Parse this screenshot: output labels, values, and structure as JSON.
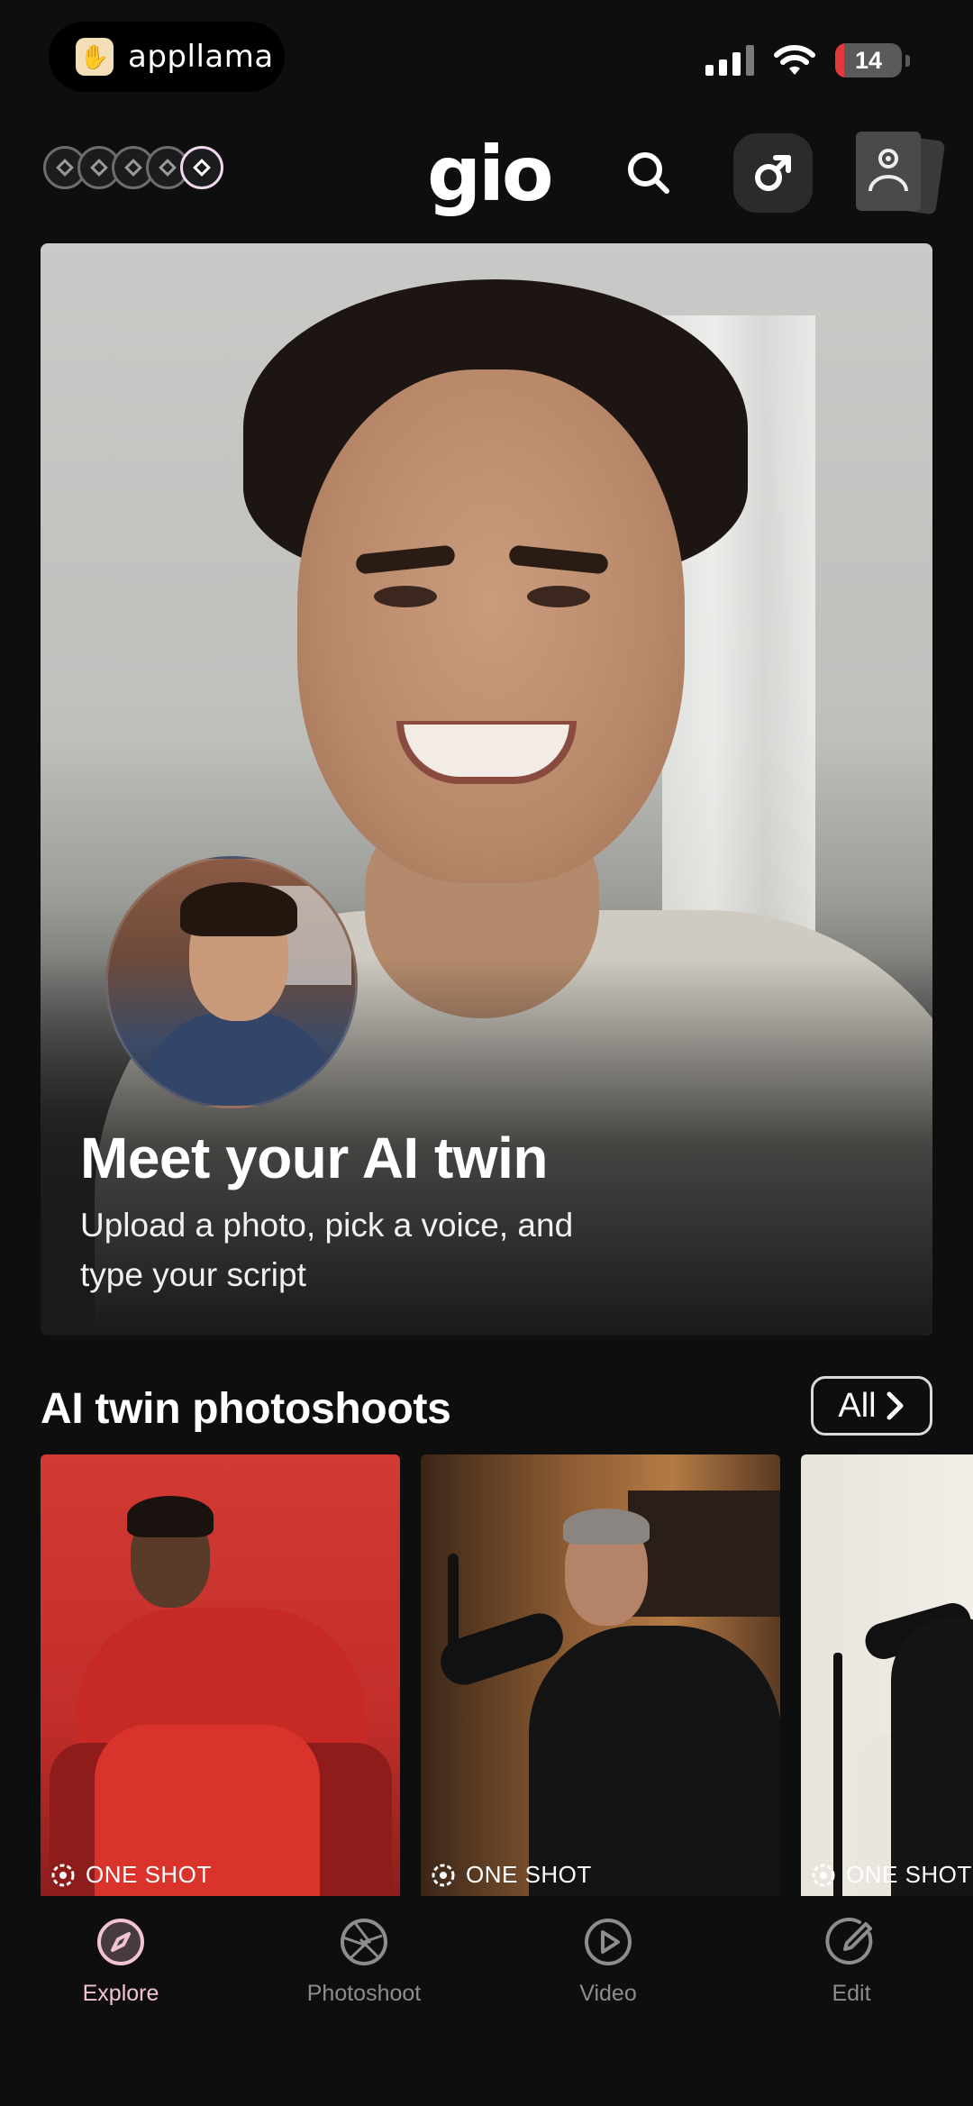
{
  "status_bar": {
    "carrier": "appllama",
    "battery_level": "14",
    "battery_fraction": 0.14,
    "battery_color": "#e5383b"
  },
  "header": {
    "logo": "gio",
    "coins_count": 5
  },
  "hero": {
    "title": "Meet your AI twin",
    "subtitle": "Upload a photo, pick a voice, and type your script"
  },
  "photoshoots": {
    "title": "AI twin photoshoots",
    "all_label": "All",
    "cards": [
      {
        "badge": "ONE SHOT",
        "theme": "red suit on red backdrop"
      },
      {
        "badge": "ONE SHOT",
        "theme": "podcast studio"
      },
      {
        "badge": "ONE SHOT",
        "theme": "white interior podcast"
      }
    ]
  },
  "bottom_nav": {
    "items": [
      {
        "label": "Explore",
        "icon": "compass-icon",
        "active": true
      },
      {
        "label": "Photoshoot",
        "icon": "aperture-icon",
        "active": false
      },
      {
        "label": "Video",
        "icon": "play-icon",
        "active": false
      },
      {
        "label": "Edit",
        "icon": "pencil-icon",
        "active": false
      }
    ],
    "active_color": "#f2c4d2"
  }
}
